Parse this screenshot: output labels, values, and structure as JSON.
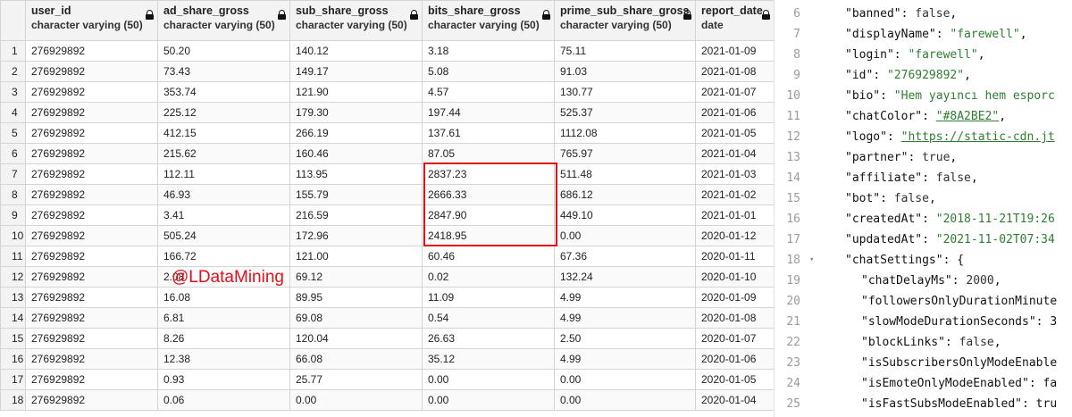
{
  "grid": {
    "columns": [
      {
        "name": "user_id",
        "type": "character varying (50)",
        "locked": true
      },
      {
        "name": "ad_share_gross",
        "type": "character varying (50)",
        "locked": true
      },
      {
        "name": "sub_share_gross",
        "type": "character varying (50)",
        "locked": true
      },
      {
        "name": "bits_share_gross",
        "type": "character varying (50)",
        "locked": true
      },
      {
        "name": "prime_sub_share_gross",
        "type": "character varying (50)",
        "locked": true
      },
      {
        "name": "report_date",
        "type": "date",
        "locked": true
      }
    ],
    "rows": [
      [
        "1",
        "276929892",
        "50.20",
        "140.12",
        "3.18",
        "75.11",
        "2021-01-09"
      ],
      [
        "2",
        "276929892",
        "73.43",
        "149.17",
        "5.08",
        "91.03",
        "2021-01-08"
      ],
      [
        "3",
        "276929892",
        "353.74",
        "121.90",
        "4.57",
        "130.77",
        "2021-01-07"
      ],
      [
        "4",
        "276929892",
        "225.12",
        "179.30",
        "197.44",
        "525.37",
        "2021-01-06"
      ],
      [
        "5",
        "276929892",
        "412.15",
        "266.19",
        "137.61",
        "1112.08",
        "2021-01-05"
      ],
      [
        "6",
        "276929892",
        "215.62",
        "160.46",
        "87.05",
        "765.97",
        "2021-01-04"
      ],
      [
        "7",
        "276929892",
        "112.11",
        "113.95",
        "2837.23",
        "511.48",
        "2021-01-03"
      ],
      [
        "8",
        "276929892",
        "46.93",
        "155.79",
        "2666.33",
        "686.12",
        "2021-01-02"
      ],
      [
        "9",
        "276929892",
        "3.41",
        "216.59",
        "2847.90",
        "449.10",
        "2021-01-01"
      ],
      [
        "10",
        "276929892",
        "505.24",
        "172.96",
        "2418.95",
        "0.00",
        "2020-01-12"
      ],
      [
        "11",
        "276929892",
        "166.72",
        "121.00",
        "60.46",
        "67.36",
        "2020-01-11"
      ],
      [
        "12",
        "276929892",
        "2.08",
        "69.12",
        "0.02",
        "132.24",
        "2020-01-10"
      ],
      [
        "13",
        "276929892",
        "16.08",
        "89.95",
        "11.09",
        "4.99",
        "2020-01-09"
      ],
      [
        "14",
        "276929892",
        "6.81",
        "69.08",
        "0.54",
        "4.99",
        "2020-01-08"
      ],
      [
        "15",
        "276929892",
        "8.26",
        "120.04",
        "26.63",
        "2.50",
        "2020-01-07"
      ],
      [
        "16",
        "276929892",
        "12.38",
        "66.08",
        "35.12",
        "4.99",
        "2020-01-06"
      ],
      [
        "17",
        "276929892",
        "0.93",
        "25.77",
        "0.00",
        "0.00",
        "2020-01-05"
      ],
      [
        "18",
        "276929892",
        "0.06",
        "0.00",
        "0.00",
        "0.00",
        "2020-01-04"
      ]
    ],
    "highlight_rows": [
      "7",
      "8",
      "9",
      "10"
    ],
    "highlight_column": "bits_share_gross",
    "highlight_color": "#e0111b"
  },
  "watermark": "@LDataMining",
  "editor": {
    "lines": [
      {
        "n": "6",
        "parts": [
          [
            "k",
            "\"banned\""
          ],
          [
            "p",
            ": "
          ],
          [
            "w",
            "false"
          ],
          [
            "p",
            ","
          ]
        ]
      },
      {
        "n": "7",
        "parts": [
          [
            "k",
            "\"displayName\""
          ],
          [
            "p",
            ": "
          ],
          [
            "s",
            "\"farewell\""
          ],
          [
            "p",
            ","
          ]
        ]
      },
      {
        "n": "8",
        "parts": [
          [
            "k",
            "\"login\""
          ],
          [
            "p",
            ": "
          ],
          [
            "s",
            "\"farewell\""
          ],
          [
            "p",
            ","
          ]
        ]
      },
      {
        "n": "9",
        "parts": [
          [
            "k",
            "\"id\""
          ],
          [
            "p",
            ": "
          ],
          [
            "s",
            "\"276929892\""
          ],
          [
            "p",
            ","
          ]
        ]
      },
      {
        "n": "10",
        "parts": [
          [
            "k",
            "\"bio\""
          ],
          [
            "p",
            ": "
          ],
          [
            "s",
            "\"Hem yayıncı hem esporc"
          ]
        ]
      },
      {
        "n": "11",
        "parts": [
          [
            "k",
            "\"chatColor\""
          ],
          [
            "p",
            ": "
          ],
          [
            "l",
            "\"#8A2BE2\""
          ],
          [
            "p",
            ","
          ]
        ]
      },
      {
        "n": "12",
        "parts": [
          [
            "k",
            "\"logo\""
          ],
          [
            "p",
            ": "
          ],
          [
            "l",
            "\"https://static-cdn.jt"
          ]
        ]
      },
      {
        "n": "13",
        "parts": [
          [
            "k",
            "\"partner\""
          ],
          [
            "p",
            ": "
          ],
          [
            "w",
            "true"
          ],
          [
            "p",
            ","
          ]
        ]
      },
      {
        "n": "14",
        "parts": [
          [
            "k",
            "\"affiliate\""
          ],
          [
            "p",
            ": "
          ],
          [
            "w",
            "false"
          ],
          [
            "p",
            ","
          ]
        ]
      },
      {
        "n": "15",
        "parts": [
          [
            "k",
            "\"bot\""
          ],
          [
            "p",
            ": "
          ],
          [
            "w",
            "false"
          ],
          [
            "p",
            ","
          ]
        ]
      },
      {
        "n": "16",
        "parts": [
          [
            "k",
            "\"createdAt\""
          ],
          [
            "p",
            ": "
          ],
          [
            "s",
            "\"2018-11-21T19:26"
          ]
        ]
      },
      {
        "n": "17",
        "parts": [
          [
            "k",
            "\"updatedAt\""
          ],
          [
            "p",
            ": "
          ],
          [
            "s",
            "\"2021-11-02T07:34"
          ]
        ]
      },
      {
        "n": "18",
        "fold": true,
        "parts": [
          [
            "k",
            "\"chatSettings\""
          ],
          [
            "p",
            ": {"
          ]
        ]
      },
      {
        "n": "19",
        "indent": true,
        "parts": [
          [
            "k",
            "\"chatDelayMs\""
          ],
          [
            "p",
            ": "
          ],
          [
            "w",
            "2000"
          ],
          [
            "p",
            ","
          ]
        ]
      },
      {
        "n": "20",
        "indent": true,
        "parts": [
          [
            "k",
            "\"followersOnlyDurationMinute"
          ]
        ]
      },
      {
        "n": "21",
        "indent": true,
        "parts": [
          [
            "k",
            "\"slowModeDurationSeconds\""
          ],
          [
            "p",
            ": 3"
          ]
        ]
      },
      {
        "n": "22",
        "indent": true,
        "parts": [
          [
            "k",
            "\"blockLinks\""
          ],
          [
            "p",
            ": "
          ],
          [
            "w",
            "false"
          ],
          [
            "p",
            ","
          ]
        ]
      },
      {
        "n": "23",
        "indent": true,
        "parts": [
          [
            "k",
            "\"isSubscribersOnlyModeEnable"
          ]
        ]
      },
      {
        "n": "24",
        "indent": true,
        "parts": [
          [
            "k",
            "\"isEmoteOnlyModeEnabled\""
          ],
          [
            "p",
            ": fa"
          ]
        ]
      },
      {
        "n": "25",
        "indent": true,
        "parts": [
          [
            "k",
            "\"isFastSubsModeEnabled\""
          ],
          [
            "p",
            ": tru"
          ]
        ]
      }
    ]
  }
}
